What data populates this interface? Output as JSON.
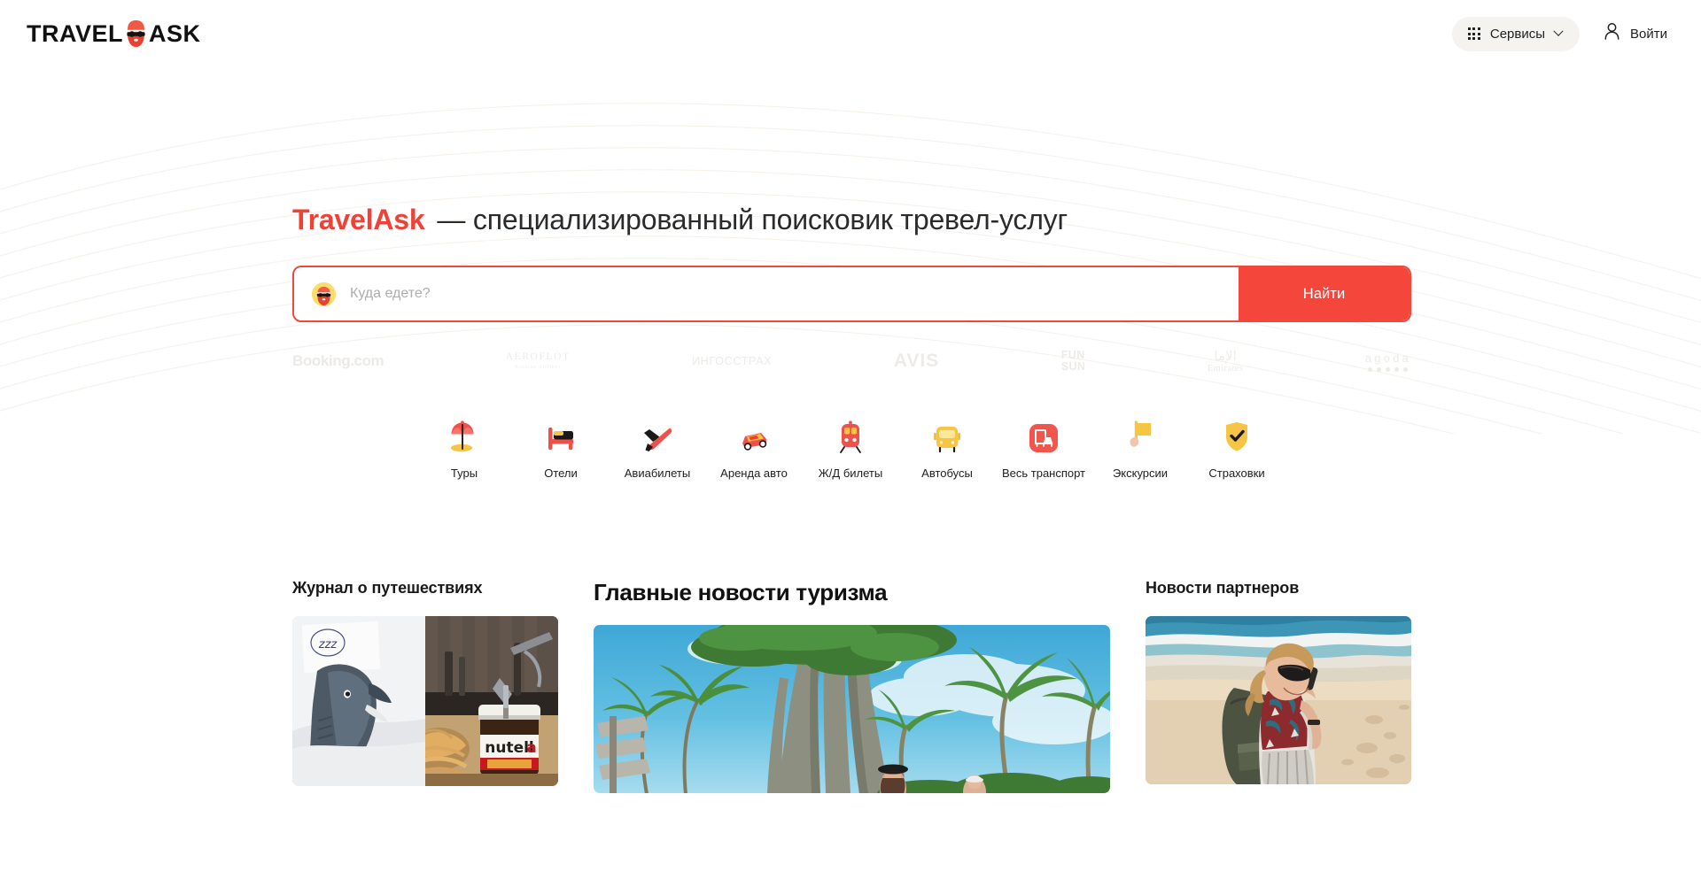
{
  "brand": {
    "logo_prefix": "TRAVEL",
    "logo_suffix": "ASK",
    "accent_color": "#EF4136",
    "search_button_color": "#F5463C"
  },
  "header": {
    "services_label": "Сервисы",
    "login_label": "Войти"
  },
  "hero": {
    "brand_word": "TravelAsk",
    "tagline": "— специализированный поисковик тревел-услуг"
  },
  "search": {
    "placeholder": "Куда едете?",
    "value": "",
    "button_label": "Найти"
  },
  "partners": [
    {
      "name": "Booking.com",
      "id": "booking"
    },
    {
      "name": "AEROFLOT",
      "sub": "Russian Airlines",
      "id": "aeroflot"
    },
    {
      "name": "ИНГОССТРАХ",
      "id": "ingosstrah"
    },
    {
      "name": "AVIS",
      "id": "avis"
    },
    {
      "name": "FUN & SUN",
      "line1": "FUN",
      "line2": "SUN",
      "id": "funsun"
    },
    {
      "name": "Emirates",
      "id": "emirates"
    },
    {
      "name": "agoda",
      "id": "agoda"
    }
  ],
  "categories": [
    {
      "label": "Туры",
      "icon": "beach-umbrella-icon"
    },
    {
      "label": "Отели",
      "icon": "bed-icon"
    },
    {
      "label": "Авиабилеты",
      "icon": "airplane-icon"
    },
    {
      "label": "Аренда авто",
      "icon": "car-icon"
    },
    {
      "label": "Ж/Д билеты",
      "icon": "train-icon"
    },
    {
      "label": "Автобусы",
      "icon": "bus-icon"
    },
    {
      "label": "Весь транспорт",
      "icon": "all-transport-icon"
    },
    {
      "label": "Экскурсии",
      "icon": "flag-icon"
    },
    {
      "label": "Страховки",
      "icon": "shield-check-icon"
    }
  ],
  "sections": {
    "magazine_title": "Журнал о путешествиях",
    "news_title": "Главные новости туризма",
    "partners_news_title": "Новости партнеров",
    "magazine_images": [
      "plush-shark-in-bed-with-zzz-note",
      "nutella-jar-with-croissants"
    ],
    "news_image": "banyan-tree-and-palms-tropical-beach",
    "partners_news_image": "woman-with-backpack-on-beach-calling"
  }
}
